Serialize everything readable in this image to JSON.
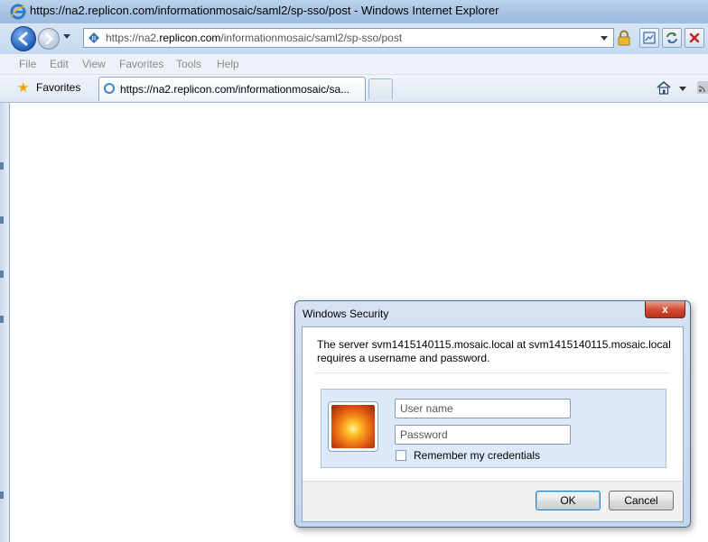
{
  "window": {
    "title": "https://na2.replicon.com/informationmosaic/saml2/sp-sso/post - Windows Internet Explorer"
  },
  "address_bar": {
    "url_prefix": "https://na2.",
    "url_domain": "replicon.com",
    "url_path": "/informationmosaic/saml2/sp-sso/post"
  },
  "menu": {
    "items": [
      "File",
      "Edit",
      "View",
      "Favorites",
      "Tools",
      "Help"
    ]
  },
  "favorites_bar": {
    "favorites_label": "Favorites"
  },
  "tabs": [
    {
      "label": "https://na2.replicon.com/informationmosaic/sa..."
    }
  ],
  "dialog": {
    "title": "Windows Security",
    "close_label": "x",
    "message_line1": "The server svm1415140115.mosaic.local at svm1415140115.mosaic.local",
    "message_line2": "requires a username and password.",
    "username_placeholder": "User name",
    "password_placeholder": "Password",
    "remember_label": "Remember my credentials",
    "ok_label": "OK",
    "cancel_label": "Cancel"
  },
  "colors": {
    "titlebar": "#a9c4e3",
    "close_button": "#cf4a31",
    "accent": "#3c7fb1"
  }
}
